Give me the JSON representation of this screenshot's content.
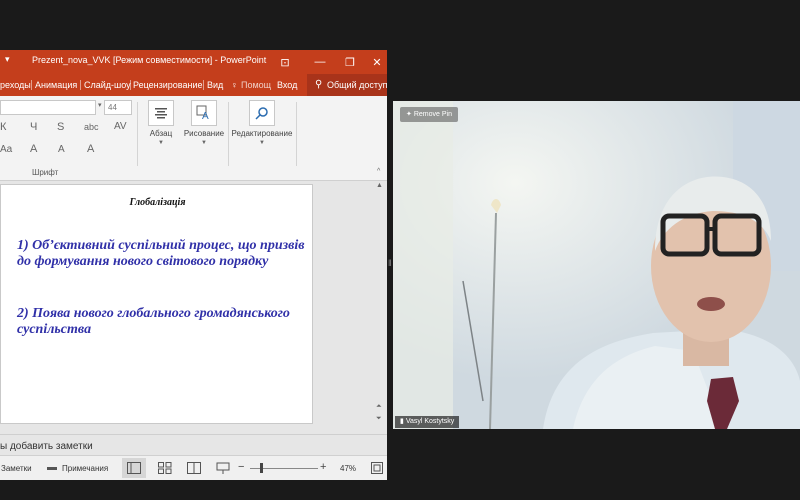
{
  "ppt": {
    "title": "Prezent_nova_VVK [Режим совместимости] - PowerPoint",
    "qat_icon": "save-icon",
    "window_buttons": [
      "ribbon-display-icon",
      "minimize-icon",
      "restore-icon",
      "close-icon"
    ],
    "tabs": [
      "реходы",
      "Анимация",
      "Слайд-шоу",
      "Рецензирование",
      "Вид"
    ],
    "tell_me": "Помощ",
    "sign_in": "Вход",
    "share": "Общий доступ",
    "ribbon": {
      "font_size": "44",
      "font_group_label": "Шрифт",
      "format_buttons": [
        "К",
        "Ч",
        "S",
        "abc",
        "AV",
        "Aa",
        "A",
        "A",
        "A"
      ],
      "groups": [
        {
          "label": "Абзац"
        },
        {
          "label": "Рисование"
        },
        {
          "label": "Редактирование"
        }
      ]
    },
    "slide": {
      "title": "Глобалізація",
      "points": [
        "1) Об’єктивний суспільний процес, що призвів до формування нового світового порядку",
        "2) Поява нового глобального громадянського суспільства"
      ]
    },
    "notes_placeholder": "ы добавить заметки",
    "status": {
      "notes": "Заметки",
      "comments": "Примечания",
      "zoom": "47%"
    }
  },
  "video": {
    "remove_pin": "Remove Pin",
    "participant_name": "Vasyl Kostytsky"
  }
}
